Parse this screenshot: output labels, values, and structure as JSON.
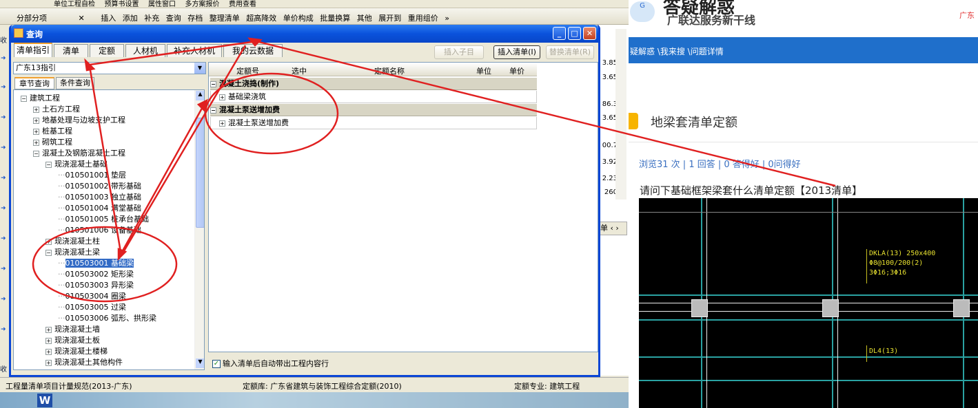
{
  "toolbar_top": {
    "items": [
      "单位工程自检",
      "预算书设置",
      "属性窗口",
      "多方案报价",
      "费用查看"
    ]
  },
  "toolbar_main": {
    "panel_label": "分部分项",
    "close_symbol": "✕",
    "items": [
      "插入",
      "添加",
      "补充",
      "查询",
      "存档",
      "整理清单",
      "超高降效",
      "单价构成",
      "批量换算",
      "其他",
      "展开到",
      "重用组价"
    ],
    "overflow": "»"
  },
  "side_tabs": [
    "收",
    "收"
  ],
  "background_values": [
    "3.85",
    "3.65",
    "86.3",
    "3.65",
    "00.7",
    "3.92",
    "2.23",
    "260"
  ],
  "background_unit": "单",
  "dialog": {
    "title": "查询",
    "tabs": [
      "清单指引",
      "清单",
      "定额",
      "人材机",
      "补充人材机",
      "我的云数据"
    ],
    "buttons": {
      "insert_child": "插入子目",
      "insert_list": "插入清单(I)",
      "replace_list": "替换清单(R)"
    },
    "combo_value": "广东13指引",
    "subtabs": [
      "章节查询",
      "条件查询"
    ],
    "tree": [
      {
        "text": "建筑工程",
        "level": 0,
        "sign": "−"
      },
      {
        "text": "土石方工程",
        "level": 1,
        "sign": "+"
      },
      {
        "text": "地基处理与边坡支护工程",
        "level": 1,
        "sign": "+"
      },
      {
        "text": "桩基工程",
        "level": 1,
        "sign": "+"
      },
      {
        "text": "砌筑工程",
        "level": 1,
        "sign": "+"
      },
      {
        "text": "混凝土及钢筋混凝土工程",
        "level": 1,
        "sign": "−"
      },
      {
        "text": "现浇混凝土基础",
        "level": 2,
        "sign": "−"
      },
      {
        "text": "010501001   垫层",
        "level": 3,
        "sign": ""
      },
      {
        "text": "010501002   带形基础",
        "level": 3,
        "sign": ""
      },
      {
        "text": "010501003   独立基础",
        "level": 3,
        "sign": ""
      },
      {
        "text": "010501004   满堂基础",
        "level": 3,
        "sign": ""
      },
      {
        "text": "010501005   桩承台基础",
        "level": 3,
        "sign": ""
      },
      {
        "text": "010501006   设备基础",
        "level": 3,
        "sign": ""
      },
      {
        "text": "现浇混凝土柱",
        "level": 2,
        "sign": "+"
      },
      {
        "text": "现浇混凝土梁",
        "level": 2,
        "sign": "−"
      },
      {
        "text": "010503001   基础梁",
        "level": 3,
        "sign": "",
        "selected": true
      },
      {
        "text": "010503002   矩形梁",
        "level": 3,
        "sign": ""
      },
      {
        "text": "010503003   异形梁",
        "level": 3,
        "sign": ""
      },
      {
        "text": "010503004   圈梁",
        "level": 3,
        "sign": ""
      },
      {
        "text": "010503005   过梁",
        "level": 3,
        "sign": ""
      },
      {
        "text": "010503006   弧形、拱形梁",
        "level": 3,
        "sign": ""
      },
      {
        "text": "现浇混凝土墙",
        "level": 2,
        "sign": "+"
      },
      {
        "text": "现浇混凝土板",
        "level": 2,
        "sign": "+"
      },
      {
        "text": "现浇混凝土楼梯",
        "level": 2,
        "sign": "+"
      },
      {
        "text": "现浇混凝土其他构件",
        "level": 2,
        "sign": "+"
      }
    ],
    "grid_headers": [
      "定额号",
      "选中",
      "定额名称",
      "单位",
      "单价"
    ],
    "groups": [
      {
        "title": "混凝土浇捣(制作)",
        "items": [
          "基础梁浇筑"
        ]
      },
      {
        "title": "混凝土泵送增加费",
        "items": [
          "混凝土泵送增加费"
        ]
      }
    ],
    "auto_checkbox": "输入清单后自动带出工程内容行"
  },
  "statusbar": {
    "left": "工程量清单项目计量规范(2013-广东)",
    "mid": "定额库: 广东省建筑与装饰工程综合定额(2010)",
    "right": "定额专业: 建筑工程"
  },
  "web": {
    "brand_line1": "答疑解惑",
    "brand_line2": "广联达服务新干线",
    "city": "广东",
    "logo_text": "G",
    "breadcrumb": "疑解惑 \\我来搜 \\问题详情",
    "question_title": "地梁套清单定额",
    "stats": "浏览31 次 | 1 回答 | 0 答得好 | 0问得好",
    "question_text": "请问下基础框架梁套什么清单定额【2013清单】",
    "cad_labels": {
      "beam1": "DKLA(13) 250x400",
      "beam1_line2": "Φ8@100/200(2)",
      "beam1_line3": "3Φ16;3Φ16",
      "beam2": "DL4(13)"
    }
  },
  "colors": {
    "xp_blue": "#0a46d6",
    "annotation_red": "#e02020",
    "nav_blue": "#1f6fcb",
    "selection": "#316ac5"
  }
}
